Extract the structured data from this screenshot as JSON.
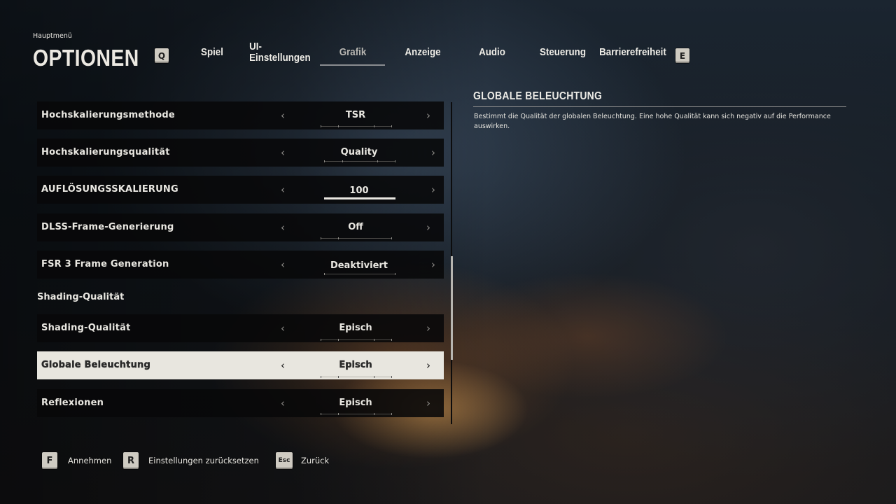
{
  "header": {
    "breadcrumb": "Hauptmenü",
    "title": "OPTIONEN",
    "prev_key": "Q",
    "next_key": "E"
  },
  "tabs": [
    {
      "label": "Spiel",
      "active": false
    },
    {
      "label": "UI-Einstellungen",
      "active": false
    },
    {
      "label": "Grafik",
      "active": true
    },
    {
      "label": "Anzeige",
      "active": false
    },
    {
      "label": "Audio",
      "active": false
    },
    {
      "label": "Steuerung",
      "active": false
    },
    {
      "label": "Barrierefreiheit",
      "active": false
    }
  ],
  "settings": {
    "rows": [
      {
        "label": "Hochskalierungsmethode",
        "value": "TSR"
      },
      {
        "label": "Hochskalierungsqualität",
        "value": "Quality"
      },
      {
        "label": "AUFLÖSUNGSSKALIERUNG",
        "value": "100"
      },
      {
        "label": "DLSS-Frame-Generierung",
        "value": "Off"
      },
      {
        "label": "FSR 3 Frame Generation",
        "value": "Deaktiviert"
      }
    ],
    "section": "Shading-Qualität",
    "shading_rows": [
      {
        "label": "Shading-Qualität",
        "value": "Episch"
      },
      {
        "label": "Globale Beleuchtung",
        "value": "Episch",
        "selected": true
      },
      {
        "label": "Reflexionen",
        "value": "Episch"
      }
    ],
    "arrow_left": "‹",
    "arrow_right": "›"
  },
  "info": {
    "title": "GLOBALE BELEUCHTUNG",
    "description": "Bestimmt die Qualität der globalen Beleuchtung. Eine hohe Qualität kann sich negativ auf die Performance auswirken."
  },
  "footer": [
    {
      "key": "F",
      "label": "Annehmen"
    },
    {
      "key": "R",
      "label": "Einstellungen zurücksetzen"
    },
    {
      "key": "Esc",
      "label": "Zurück"
    }
  ],
  "colors": {
    "selected_row_bg": "#e8e6df",
    "row_bg": "#080809",
    "text": "#e9e7e1"
  }
}
